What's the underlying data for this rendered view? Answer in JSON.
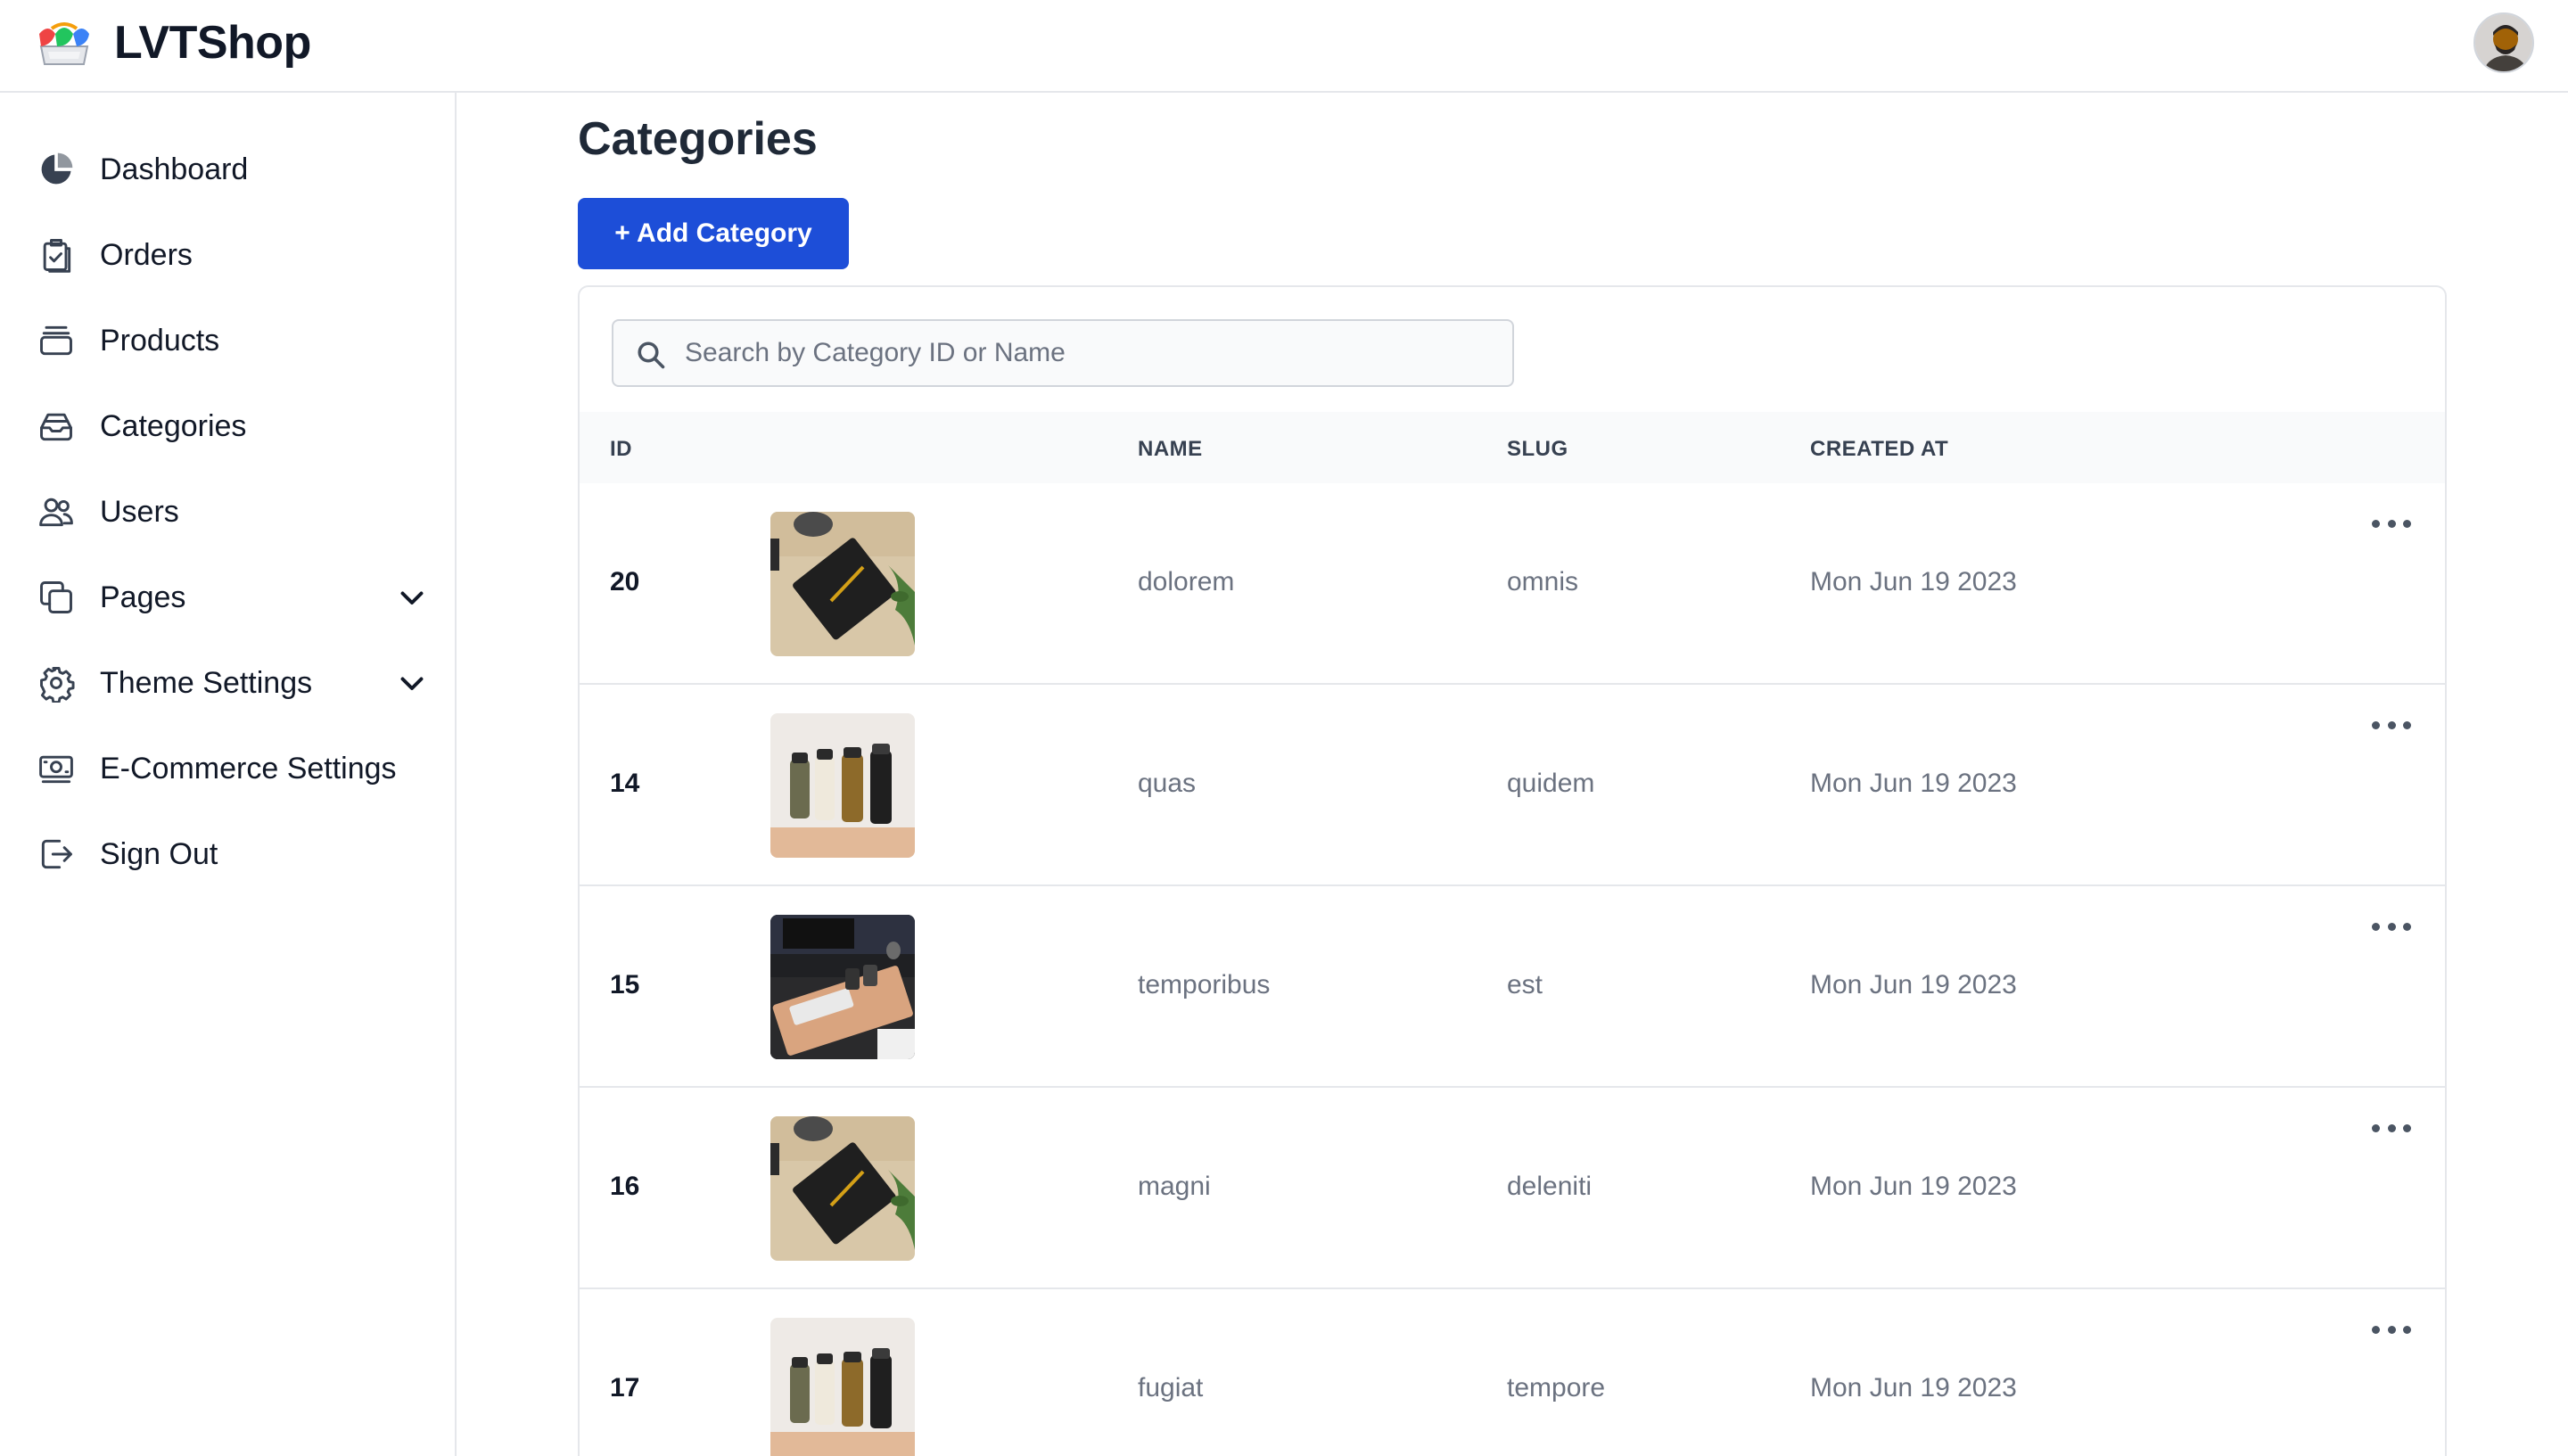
{
  "app": {
    "brand": "LVTShop",
    "logo_icon": "storefront-awning-logo",
    "avatar_icon": "user-avatar",
    "accent": "#1d4ed8"
  },
  "sidebar": {
    "items": [
      {
        "label": "Dashboard",
        "icon": "pie-chart-icon"
      },
      {
        "label": "Orders",
        "icon": "clipboard-check-icon"
      },
      {
        "label": "Products",
        "icon": "archive-box-icon"
      },
      {
        "label": "Categories",
        "icon": "inbox-stack-icon"
      },
      {
        "label": "Users",
        "icon": "users-icon"
      },
      {
        "label": "Pages",
        "icon": "copy-pages-icon",
        "expandable": true
      },
      {
        "label": "Theme Settings",
        "icon": "gear-icon",
        "expandable": true
      },
      {
        "label": "E-Commerce Settings",
        "icon": "cash-icon"
      },
      {
        "label": "Sign Out",
        "icon": "sign-out-icon"
      }
    ]
  },
  "main": {
    "title": "Categories",
    "add_button": "+ Add Category",
    "search_placeholder": "Search by Category ID or Name",
    "columns": {
      "id": "ID",
      "name": "NAME",
      "slug": "SLUG",
      "created_at": "CREATED AT"
    },
    "rows": [
      {
        "id": "20",
        "name": "dolorem",
        "slug": "omnis",
        "created_at": "Mon Jun 19 2023",
        "image": "notebook-photo"
      },
      {
        "id": "14",
        "name": "quas",
        "slug": "quidem",
        "created_at": "Mon Jun 19 2023",
        "image": "bottles-photo"
      },
      {
        "id": "15",
        "name": "temporibus",
        "slug": "est",
        "created_at": "Mon Jun 19 2023",
        "image": "desk-photo"
      },
      {
        "id": "16",
        "name": "magni",
        "slug": "deleniti",
        "created_at": "Mon Jun 19 2023",
        "image": "notebook-photo"
      },
      {
        "id": "17",
        "name": "fugiat",
        "slug": "tempore",
        "created_at": "Mon Jun 19 2023",
        "image": "bottles-photo"
      }
    ]
  }
}
